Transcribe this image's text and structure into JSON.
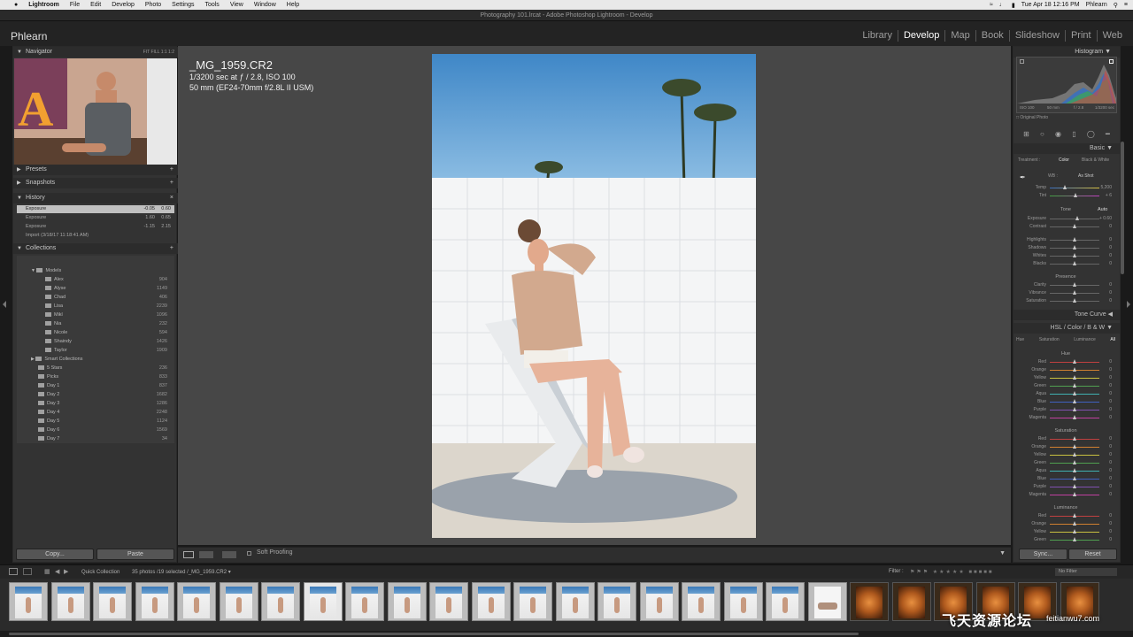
{
  "menubar": {
    "app": "Lightroom",
    "items": [
      "File",
      "Edit",
      "Develop",
      "Photo",
      "Settings",
      "Tools",
      "View",
      "Window",
      "Help"
    ],
    "clock": "Tue Apr 18  12:16 PM",
    "user": "Phlearn"
  },
  "window_title": "Photography 101.lrcat - Adobe Photoshop Lightroom - Develop",
  "identity": "Phlearn",
  "modules": [
    "Library",
    "Develop",
    "Map",
    "Book",
    "Slideshow",
    "Print",
    "Web"
  ],
  "active_module": "Develop",
  "left": {
    "navigator": {
      "title": "Navigator",
      "zoom_options": [
        "FIT",
        "FILL",
        "1:1",
        "1:2"
      ]
    },
    "presets": "Presets",
    "snapshots": "Snapshots",
    "history": {
      "title": "History",
      "rows": [
        {
          "label": "Exposure",
          "v1": "-0.05",
          "v2": "0.60",
          "selected": true
        },
        {
          "label": "Exposure",
          "v1": "1.60",
          "v2": "0.65"
        },
        {
          "label": "Exposure",
          "v1": "-1.15",
          "v2": "2.15"
        },
        {
          "label": "Import (3/18/17 11:18:41 AM)",
          "v1": "",
          "v2": ""
        }
      ]
    },
    "collections": {
      "title": "Collections",
      "models_label": "Models",
      "models": [
        {
          "name": "Alex",
          "count": "904"
        },
        {
          "name": "Alyse",
          "count": "1149"
        },
        {
          "name": "Chad",
          "count": "406"
        },
        {
          "name": "Lisa",
          "count": "2239"
        },
        {
          "name": "Mikl",
          "count": "1096"
        },
        {
          "name": "Nia",
          "count": "232"
        },
        {
          "name": "Nicole",
          "count": "594"
        },
        {
          "name": "Shaindy",
          "count": "1426"
        },
        {
          "name": "Taylor",
          "count": "1909"
        }
      ],
      "smart_label": "Smart Collections",
      "others": [
        {
          "name": "5 Stars",
          "count": "236"
        },
        {
          "name": "Picks",
          "count": "833"
        },
        {
          "name": "Day 1",
          "count": "837"
        },
        {
          "name": "Day 2",
          "count": "1682"
        },
        {
          "name": "Day 3",
          "count": "1286"
        },
        {
          "name": "Day 4",
          "count": "2248"
        },
        {
          "name": "Day 5",
          "count": "1124"
        },
        {
          "name": "Day 6",
          "count": "1569"
        },
        {
          "name": "Day 7",
          "count": "34"
        }
      ]
    },
    "copy_label": "Copy...",
    "paste_label": "Paste"
  },
  "photo_info": {
    "filename": "_MG_1959.CR2",
    "exposure_line": "1/3200 sec at ƒ / 2.8, ISO 100",
    "lens_line": "50 mm (EF24-70mm f/2.8L II USM)"
  },
  "toolbar": {
    "soft_proofing": "Soft Proofing"
  },
  "right": {
    "histogram": {
      "title": "Histogram",
      "iso": "ISO 100",
      "focal": "50 mm",
      "aperture": "f / 2.8",
      "shutter": "1/3200 sec",
      "original": "Original Photo"
    },
    "basic": {
      "title": "Basic",
      "treatment": "Treatment :",
      "color": "Color",
      "bw": "Black & White",
      "wb_label": "WB :",
      "wb_value": "As Shot",
      "temp": {
        "label": "Temp",
        "value": "5,200",
        "pos": 0.32
      },
      "tint": {
        "label": "Tint",
        "value": "+ 6",
        "pos": 0.52
      },
      "tone": "Tone",
      "auto": "Auto",
      "tone_rows": [
        {
          "label": "Exposure",
          "value": "+ 0.60",
          "pos": 0.56
        },
        {
          "label": "Contrast",
          "value": "0",
          "pos": 0.5
        },
        {
          "label": "Highlights",
          "value": "0",
          "pos": 0.5
        },
        {
          "label": "Shadows",
          "value": "0",
          "pos": 0.5
        },
        {
          "label": "Whites",
          "value": "0",
          "pos": 0.5
        },
        {
          "label": "Blacks",
          "value": "0",
          "pos": 0.5
        }
      ],
      "presence": "Presence",
      "presence_rows": [
        {
          "label": "Clarity",
          "value": "0",
          "pos": 0.5
        },
        {
          "label": "Vibrance",
          "value": "0",
          "pos": 0.5
        },
        {
          "label": "Saturation",
          "value": "0",
          "pos": 0.5
        }
      ]
    },
    "tone_curve": "Tone Curve",
    "hsl": {
      "title": "HSL  /  Color  /  B & W",
      "tabs": [
        "Hue",
        "Saturation",
        "Luminance",
        "All"
      ],
      "hue": "Hue",
      "saturation": "Saturation",
      "luminance": "Luminance",
      "colors": [
        "Red",
        "Orange",
        "Yellow",
        "Green",
        "Aqua",
        "Blue",
        "Purple",
        "Magenta"
      ],
      "color_hex": [
        "#c04040",
        "#d08030",
        "#c8c040",
        "#50a050",
        "#40b0b0",
        "#4060c0",
        "#8050b0",
        "#c040a0"
      ]
    },
    "sync_label": "Sync...",
    "reset_label": "Reset"
  },
  "filmstrip": {
    "source": "Quick Collection",
    "count": "35 photos /19 selected /_MG_1959.CR2 ▾",
    "filter_label": "Filter :",
    "filter_value": "No Filter"
  },
  "watermark": {
    "text": "飞天资源论坛",
    "url": "feitianwu7.com"
  }
}
